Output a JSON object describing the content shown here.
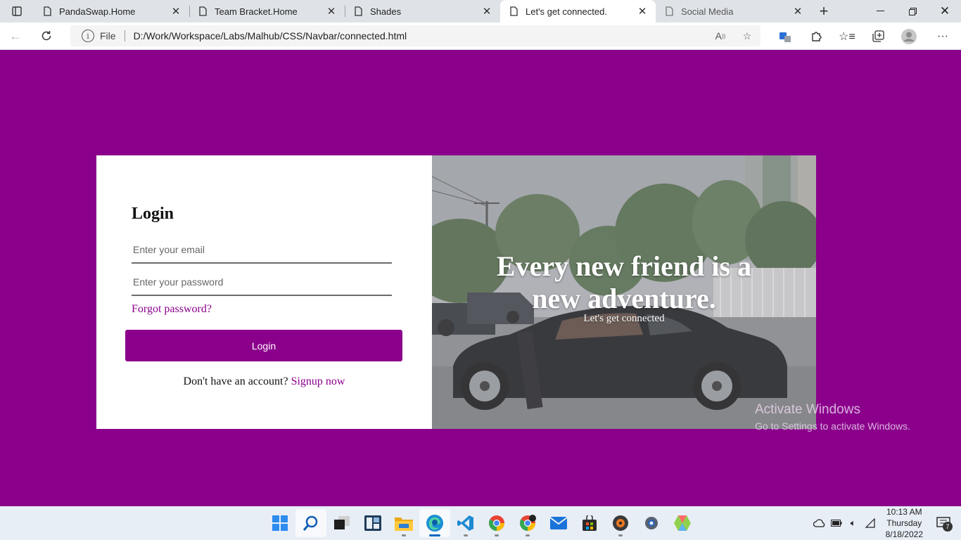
{
  "browser": {
    "tabs": [
      {
        "title": "PandaSwap.Home",
        "active": false
      },
      {
        "title": "Team Bracket.Home",
        "active": false
      },
      {
        "title": "Shades",
        "active": false
      },
      {
        "title": "Let's get connected.",
        "active": true
      },
      {
        "title": "Social Media",
        "active": false
      }
    ],
    "address": {
      "scheme": "File",
      "url": "D:/Work/Workspace/Labs/Malhub/CSS/Navbar/connected.html"
    }
  },
  "login": {
    "title": "Login",
    "email_placeholder": "Enter your email",
    "password_placeholder": "Enter your password",
    "forgot_label": "Forgot password?",
    "button_label": "Login",
    "signup_prompt": "Don't have an account?",
    "signup_link": "Signup now"
  },
  "hero": {
    "title": "Every new friend is a new adventure.",
    "subtitle": "Let's get connected"
  },
  "watermark": {
    "title": "Activate Windows",
    "subtitle": "Go to Settings to activate Windows."
  },
  "taskbar": {
    "time": "10:13 AM",
    "day": "Thursday",
    "date": "8/18/2022",
    "notifications": "7"
  },
  "colors": {
    "brand_purple": "#8b008b",
    "page_background": "#8b008b"
  }
}
